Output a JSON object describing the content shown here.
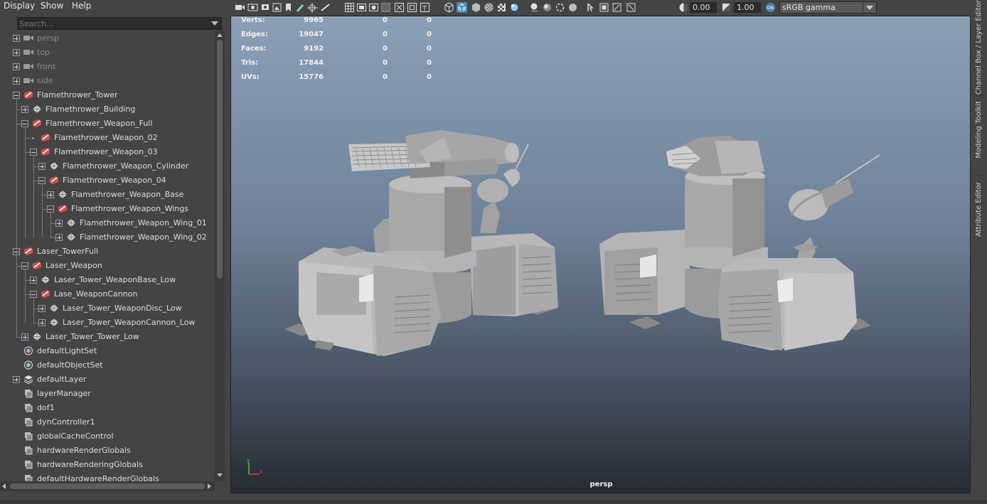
{
  "menu": {
    "display": "Display",
    "show": "Show",
    "help": "Help"
  },
  "search": {
    "placeholder": "Search..."
  },
  "outliner": {
    "items": [
      {
        "label": "persp",
        "icon": "camera-icon",
        "dim": true
      },
      {
        "label": "top",
        "icon": "camera-icon",
        "dim": true
      },
      {
        "label": "front",
        "icon": "camera-icon",
        "dim": true
      },
      {
        "label": "side",
        "icon": "camera-icon",
        "dim": true
      },
      {
        "label": "Flamethrower_Tower",
        "icon": "group-icon"
      },
      {
        "label": "Flamethrower_Building",
        "icon": "mesh-icon"
      },
      {
        "label": "Flamethrower_Weapon_Full",
        "icon": "group-icon"
      },
      {
        "label": "Flamethrower_Weapon_02",
        "icon": "group-icon"
      },
      {
        "label": "Flamethrower_Weapon_03",
        "icon": "group-icon"
      },
      {
        "label": "Flamethrower_Weapon_Cylinder",
        "icon": "mesh-icon"
      },
      {
        "label": "Flamethrower_Weapon_04",
        "icon": "group-icon"
      },
      {
        "label": "Flamethrower_Weapon_Base",
        "icon": "mesh-icon"
      },
      {
        "label": "Flamethrower_Weapon_Wings",
        "icon": "group-icon"
      },
      {
        "label": "Flamethrower_Weapon_Wing_01",
        "icon": "mesh-icon"
      },
      {
        "label": "Flamethrower_Weapon_Wing_02",
        "icon": "mesh-icon"
      },
      {
        "label": "Laser_TowerFull",
        "icon": "group-icon"
      },
      {
        "label": "Laser_Weapon",
        "icon": "group-icon"
      },
      {
        "label": "Laser_Tower_WeaponBase_Low",
        "icon": "mesh-icon"
      },
      {
        "label": "Lase_WeaponCannon",
        "icon": "group-icon"
      },
      {
        "label": "Laser_Tower_WeaponDisc_Low",
        "icon": "mesh-icon"
      },
      {
        "label": "Laser_Tower_WeaponCannon_Low",
        "icon": "mesh-icon"
      },
      {
        "label": "Laser_Tower_Tower_Low",
        "icon": "mesh-icon"
      },
      {
        "label": "defaultLightSet",
        "icon": "set-icon"
      },
      {
        "label": "defaultObjectSet",
        "icon": "set-icon"
      },
      {
        "label": "defaultLayer",
        "icon": "layer-icon"
      },
      {
        "label": "layerManager",
        "icon": "node-icon"
      },
      {
        "label": "dof1",
        "icon": "node-icon"
      },
      {
        "label": "dynController1",
        "icon": "node-icon"
      },
      {
        "label": "globalCacheControl",
        "icon": "node-icon"
      },
      {
        "label": "hardwareRenderGlobals",
        "icon": "node-icon"
      },
      {
        "label": "hardwareRenderingGlobals",
        "icon": "node-icon"
      },
      {
        "label": "defaultHardwareRenderGlobals",
        "icon": "node-icon"
      }
    ]
  },
  "toolbar": {
    "exposure": "0.00",
    "gamma": "1.00",
    "color_space": "sRGB gamma",
    "accent": "#5285a6"
  },
  "hud": [
    {
      "label": "Verts:",
      "v1": "9965",
      "v2": "0",
      "v3": "0"
    },
    {
      "label": "Edges:",
      "v1": "19047",
      "v2": "0",
      "v3": "0"
    },
    {
      "label": "Faces:",
      "v1": "9192",
      "v2": "0",
      "v3": "0"
    },
    {
      "label": "Tris:",
      "v1": "17844",
      "v2": "0",
      "v3": "0"
    },
    {
      "label": "UVs:",
      "v1": "15776",
      "v2": "0",
      "v3": "0"
    }
  ],
  "viewport": {
    "camera": "persp",
    "axis_x": "x",
    "axis_y": "y"
  },
  "side_tabs": {
    "channel_box": "Channel Box / Layer Editor",
    "modeling_toolkit": "Modeling Toolkit",
    "attribute_editor": "Attribute Editor"
  }
}
